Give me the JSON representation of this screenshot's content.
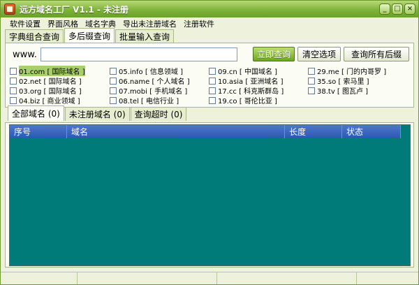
{
  "window": {
    "title": "远方域名工厂 V1.1 - 未注册"
  },
  "title_buttons": [
    "_",
    "□",
    "×"
  ],
  "menu": [
    "软件设置",
    "界面风格",
    "域名字典",
    "导出未注册域名",
    "注册软件"
  ],
  "query_tabs": [
    "字典组合查询",
    "多后缀查询",
    "批量输入查询"
  ],
  "query": {
    "www_label": "www.",
    "input_value": "",
    "btn_query": "立即查询",
    "btn_clear": "清空选项",
    "btn_query_all": "查询所有后缀"
  },
  "suffixes": [
    {
      "label": "01.com [ 国际域名 ]",
      "selected": true
    },
    {
      "label": "02.net [ 国际域名 ]"
    },
    {
      "label": "03.org [ 国际域名 ]"
    },
    {
      "label": "04.biz [ 商业领域 ]"
    },
    {
      "label": "05.info [ 信息领域 ]"
    },
    {
      "label": "06.name [ 个人域名 ]"
    },
    {
      "label": "07.mobi [ 手机域名 ]"
    },
    {
      "label": "08.tel [ 电信行业 ]"
    },
    {
      "label": "09.cn [ 中国域名 ]"
    },
    {
      "label": "10.asia [ 亚洲域名 ]"
    },
    {
      "label": "17.cc [ 科克斯群岛 ]"
    },
    {
      "label": "19.co [ 哥伦比亚 ]"
    },
    {
      "label": "29.me [ 门的内哥罗 ]"
    },
    {
      "label": "35.so [ 索马里 ]"
    },
    {
      "label": "38.tv [ 图瓦卢 ]"
    }
  ],
  "result_tabs": [
    "全部域名 (0)",
    "未注册域名 (0)",
    "查询超时 (0)"
  ],
  "columns": [
    "序号",
    "域名",
    "长度",
    "状态"
  ]
}
